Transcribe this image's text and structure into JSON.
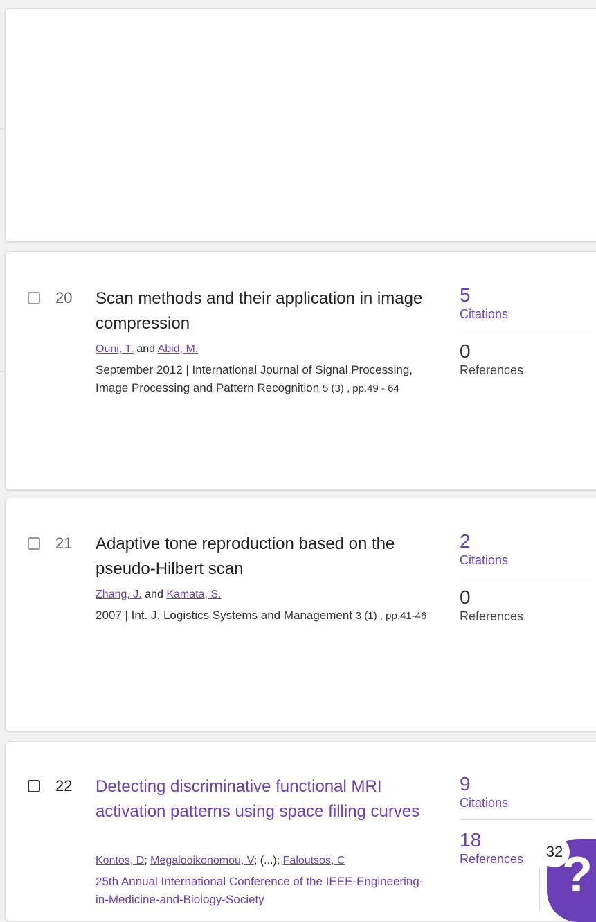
{
  "results": [
    {
      "number": "20",
      "title": "Scan methods and their application in image compression",
      "title_is_link": false,
      "authors": [
        "Ouni, T.",
        "Abid, M."
      ],
      "author_joiner": "and",
      "meta_line": "September 2012 | International Journal of Signal Processing, Image Processing and Pattern Recognition",
      "meta_tail": "5 (3) , pp.49 - 64",
      "citations": "5",
      "citations_label": "Citations",
      "references": "0",
      "references_label": "References"
    },
    {
      "number": "21",
      "title": "Adaptive tone reproduction based on the pseudo-Hilbert scan",
      "title_is_link": false,
      "authors": [
        "Zhang, J.",
        "Kamata, S."
      ],
      "author_joiner": "and",
      "meta_line": "2007 | Int. J. Logistics Systems and Management",
      "meta_tail": "3 (1) , pp.41-46",
      "citations": "2",
      "citations_label": "Citations",
      "references": "0",
      "references_label": "References"
    },
    {
      "number": "22",
      "title": "Detecting discriminative functional MRI activation patterns using space filling curves",
      "title_is_link": true,
      "authors": [
        "Kontos, D",
        "Megalooikonomou, V",
        "(...)",
        "Faloutsos, C"
      ],
      "meta_line": "25th Annual International Conference of the IEEE-Engineering-in-Medicine-and-Biology-Society",
      "citations": "9",
      "citations_label": "Citations",
      "references": "18",
      "references_label": "References"
    }
  ],
  "help": {
    "count": "32",
    "icon": "question-mark-icon",
    "color": "#6b3fb5"
  },
  "colors": {
    "accent": "#6b3fb5",
    "background": "#f2f2f2",
    "card": "#ffffff"
  }
}
